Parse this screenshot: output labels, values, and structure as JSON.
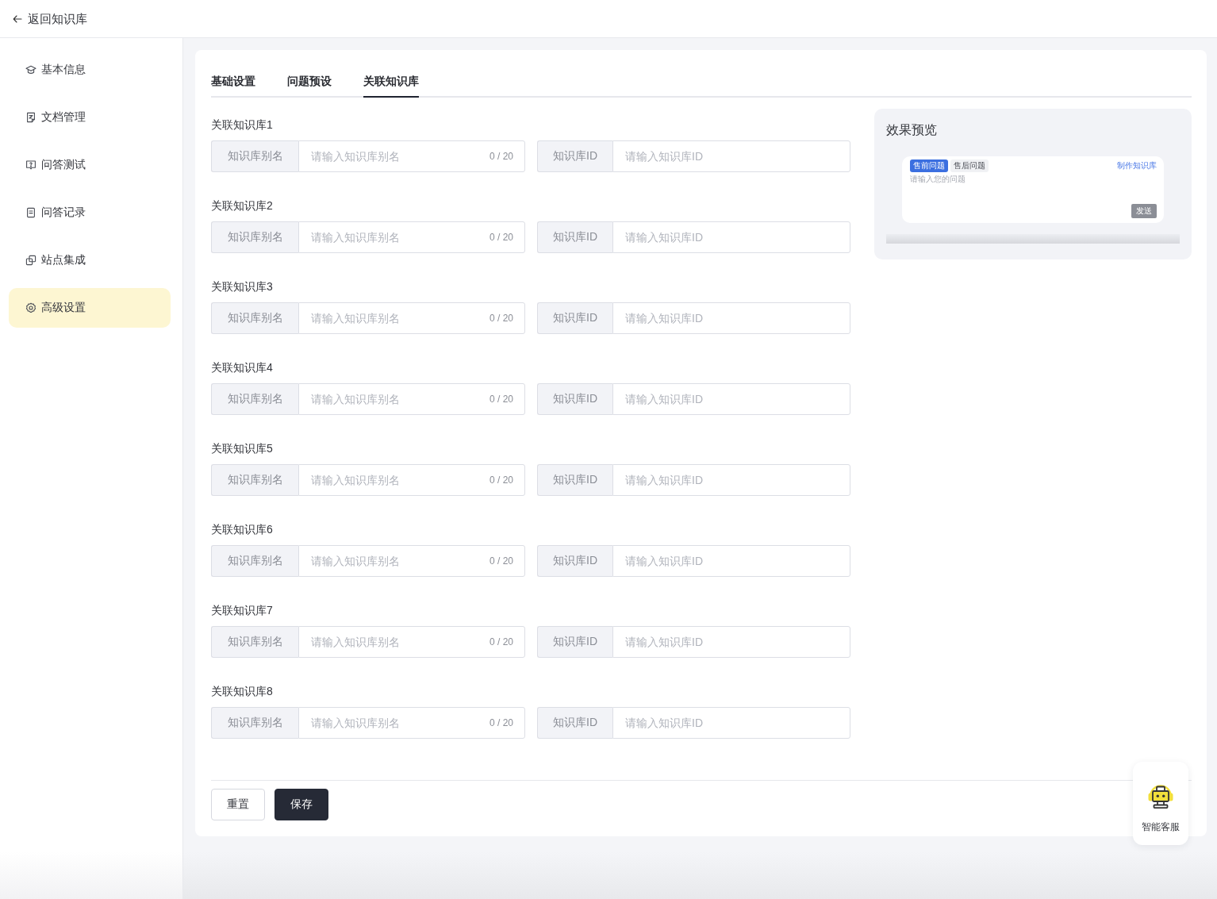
{
  "header": {
    "back_label": "返回知识库"
  },
  "sidebar": {
    "items": [
      {
        "label": "基本信息",
        "selected": false
      },
      {
        "label": "文档管理",
        "selected": false
      },
      {
        "label": "问答测试",
        "selected": false
      },
      {
        "label": "问答记录",
        "selected": false
      },
      {
        "label": "站点集成",
        "selected": false
      },
      {
        "label": "高级设置",
        "selected": true
      }
    ]
  },
  "tabs": [
    {
      "label": "基础设置",
      "selected": false
    },
    {
      "label": "问题预设",
      "selected": false
    },
    {
      "label": "关联知识库",
      "selected": true
    }
  ],
  "knowledge_bases": [
    {
      "title": "关联知识库1",
      "alias": {
        "addon": "知识库别名",
        "placeholder": "请输入知识库别名",
        "counter": "0 / 20"
      },
      "id": {
        "addon": "知识库ID",
        "placeholder": "请输入知识库ID"
      }
    },
    {
      "title": "关联知识库2",
      "alias": {
        "addon": "知识库别名",
        "placeholder": "请输入知识库别名",
        "counter": "0 / 20"
      },
      "id": {
        "addon": "知识库ID",
        "placeholder": "请输入知识库ID"
      }
    },
    {
      "title": "关联知识库3",
      "alias": {
        "addon": "知识库别名",
        "placeholder": "请输入知识库别名",
        "counter": "0 / 20"
      },
      "id": {
        "addon": "知识库ID",
        "placeholder": "请输入知识库ID"
      }
    },
    {
      "title": "关联知识库4",
      "alias": {
        "addon": "知识库别名",
        "placeholder": "请输入知识库别名",
        "counter": "0 / 20"
      },
      "id": {
        "addon": "知识库ID",
        "placeholder": "请输入知识库ID"
      }
    },
    {
      "title": "关联知识库5",
      "alias": {
        "addon": "知识库别名",
        "placeholder": "请输入知识库别名",
        "counter": "0 / 20"
      },
      "id": {
        "addon": "知识库ID",
        "placeholder": "请输入知识库ID"
      }
    },
    {
      "title": "关联知识库6",
      "alias": {
        "addon": "知识库别名",
        "placeholder": "请输入知识库别名",
        "counter": "0 / 20"
      },
      "id": {
        "addon": "知识库ID",
        "placeholder": "请输入知识库ID"
      }
    },
    {
      "title": "关联知识库7",
      "alias": {
        "addon": "知识库别名",
        "placeholder": "请输入知识库别名",
        "counter": "0 / 20"
      },
      "id": {
        "addon": "知识库ID",
        "placeholder": "请输入知识库ID"
      }
    },
    {
      "title": "关联知识库8",
      "alias": {
        "addon": "知识库别名",
        "placeholder": "请输入知识库别名",
        "counter": "0 / 20"
      },
      "id": {
        "addon": "知识库ID",
        "placeholder": "请输入知识库ID"
      }
    }
  ],
  "preview": {
    "title": "效果预览",
    "tags": [
      {
        "label": "售前问题",
        "selected": true
      },
      {
        "label": "售后问题",
        "selected": false
      }
    ],
    "link": "制作知识库",
    "placeholder": "请输入您的问题",
    "send_button": {
      "label": "发送",
      "disabled": true
    }
  },
  "actions": [
    {
      "label": "重置",
      "kind": "secondary"
    },
    {
      "label": "保存",
      "kind": "primary"
    }
  ],
  "support_widget": {
    "label": "智能客服"
  }
}
